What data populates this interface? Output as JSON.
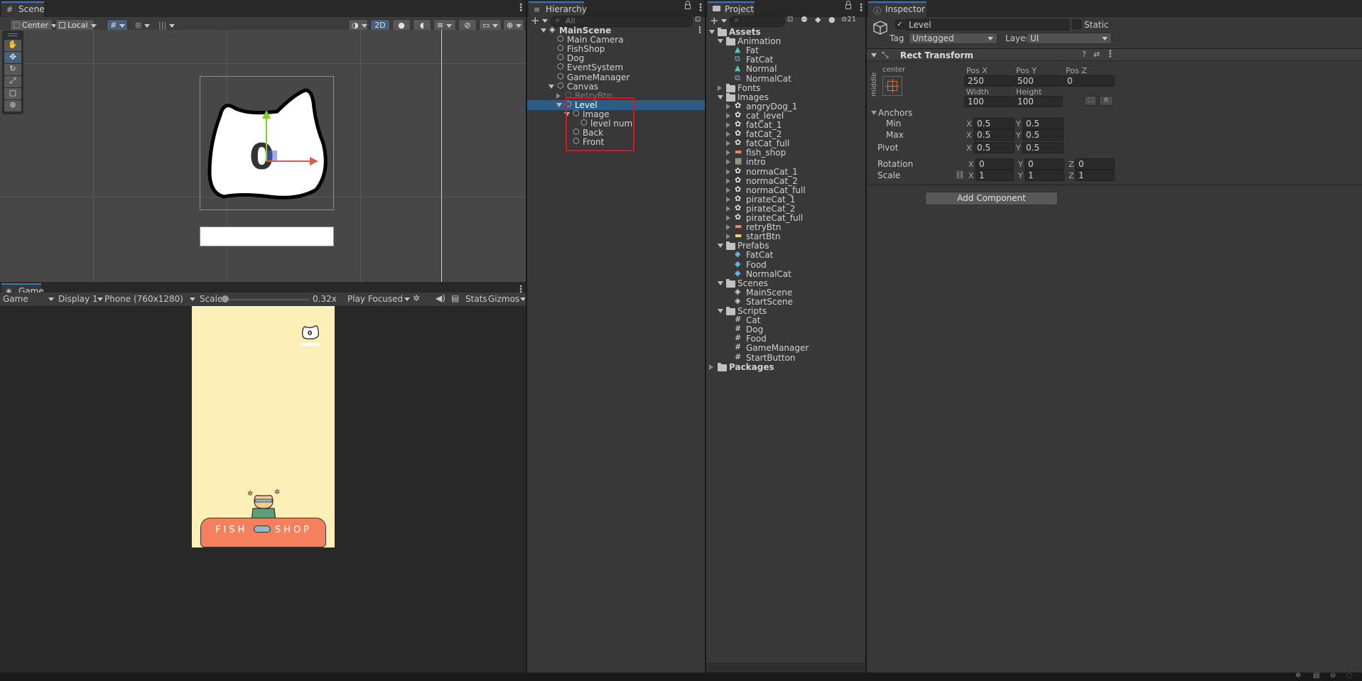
{
  "scene": {
    "tab": "Scene",
    "toolbar": {
      "pivot": "Center",
      "space": "Local",
      "mode2d": "2D"
    },
    "level_text": "0"
  },
  "game": {
    "tab": "Game",
    "view": "Game",
    "display": "Display 1",
    "resolution": "Phone (760x1280)",
    "scale_label": "Scale",
    "scale_value": "0.32x",
    "scale_fraction": 0.02,
    "play_mode": "Play Focused",
    "stats": "Stats",
    "gizmos": "Gizmos",
    "level_badge": "0",
    "shop_left": "FISH",
    "shop_right": "SHOP"
  },
  "hierarchy": {
    "tab": "Hierarchy",
    "search_placeholder": "All",
    "items": [
      {
        "label": "MainScene",
        "type": "scene"
      },
      {
        "label": "Main Camera",
        "type": "go"
      },
      {
        "label": "FishShop",
        "type": "go"
      },
      {
        "label": "Dog",
        "type": "go"
      },
      {
        "label": "EventSystem",
        "type": "go"
      },
      {
        "label": "GameManager",
        "type": "go"
      },
      {
        "label": "Canvas",
        "type": "go"
      },
      {
        "label": "RetryBtn",
        "type": "go-disabled"
      },
      {
        "label": "Level",
        "type": "go-selected"
      },
      {
        "label": "Image",
        "type": "go"
      },
      {
        "label": "level num",
        "type": "go"
      },
      {
        "label": "Back",
        "type": "go"
      },
      {
        "label": "Front",
        "type": "go"
      }
    ]
  },
  "project": {
    "tab": "Project",
    "hidden_count": "21",
    "items": [
      {
        "label": "Assets",
        "kind": "folder"
      },
      {
        "label": "Animation",
        "kind": "folder"
      },
      {
        "label": "Fat",
        "kind": "anim"
      },
      {
        "label": "FatCat",
        "kind": "ctrl"
      },
      {
        "label": "Normal",
        "kind": "anim"
      },
      {
        "label": "NormalCat",
        "kind": "ctrl"
      },
      {
        "label": "Fonts",
        "kind": "folder"
      },
      {
        "label": "Images",
        "kind": "folder"
      },
      {
        "label": "angryDog_1",
        "kind": "img"
      },
      {
        "label": "cat_level",
        "kind": "img"
      },
      {
        "label": "fatCat_1",
        "kind": "img"
      },
      {
        "label": "fatCat_2",
        "kind": "img"
      },
      {
        "label": "fatCat_full",
        "kind": "img"
      },
      {
        "label": "fish_shop",
        "kind": "img-orange"
      },
      {
        "label": "intro",
        "kind": "img-doc"
      },
      {
        "label": "normaCat_1",
        "kind": "img"
      },
      {
        "label": "normaCat_2",
        "kind": "img"
      },
      {
        "label": "normaCat_full",
        "kind": "img"
      },
      {
        "label": "pirateCat_1",
        "kind": "img"
      },
      {
        "label": "pirateCat_2",
        "kind": "img"
      },
      {
        "label": "pirateCat_full",
        "kind": "img"
      },
      {
        "label": "retryBtn",
        "kind": "img-orange"
      },
      {
        "label": "startBtn",
        "kind": "img-yellow"
      },
      {
        "label": "Prefabs",
        "kind": "folder"
      },
      {
        "label": "FatCat",
        "kind": "prefab"
      },
      {
        "label": "Food",
        "kind": "prefab"
      },
      {
        "label": "NormalCat",
        "kind": "prefab"
      },
      {
        "label": "Scenes",
        "kind": "folder"
      },
      {
        "label": "MainScene",
        "kind": "scene"
      },
      {
        "label": "StartScene",
        "kind": "scene"
      },
      {
        "label": "Scripts",
        "kind": "folder"
      },
      {
        "label": "Cat",
        "kind": "script"
      },
      {
        "label": "Dog",
        "kind": "script"
      },
      {
        "label": "Food",
        "kind": "script"
      },
      {
        "label": "GameManager",
        "kind": "script"
      },
      {
        "label": "StartButton",
        "kind": "script"
      },
      {
        "label": "Packages",
        "kind": "folder"
      }
    ]
  },
  "inspector": {
    "tab": "Inspector",
    "object_name": "Level",
    "static_label": "Static",
    "tag_label": "Tag",
    "tag_value": "Untagged",
    "layer_label": "Layer",
    "layer_value": "UI",
    "component": "Rect Transform",
    "anchor_h": "center",
    "anchor_v": "middle",
    "pos_x_label": "Pos X",
    "pos_y_label": "Pos Y",
    "pos_z_label": "Pos Z",
    "pos_x": "250",
    "pos_y": "500",
    "pos_z": "0",
    "width_label": "Width",
    "height_label": "Height",
    "width": "100",
    "height": "100",
    "r_button": "R",
    "anchors_label": "Anchors",
    "min_label": "Min",
    "max_label": "Max",
    "pivot_label": "Pivot",
    "anchor_min_x": "0.5",
    "anchor_min_y": "0.5",
    "anchor_max_x": "0.5",
    "anchor_max_y": "0.5",
    "pivot_x": "0.5",
    "pivot_y": "0.5",
    "rotation_label": "Rotation",
    "scale_label": "Scale",
    "rot_x": "0",
    "rot_y": "0",
    "rot_z": "0",
    "scale_x": "1",
    "scale_y": "1",
    "scale_z": "1",
    "x": "X",
    "y": "Y",
    "z": "Z",
    "add_component": "Add Component"
  },
  "colors": {
    "accent": "#2c5d87",
    "highlight_box": "#e0121b",
    "game_bg": "#fdefb8",
    "shop": "#f4805d"
  }
}
